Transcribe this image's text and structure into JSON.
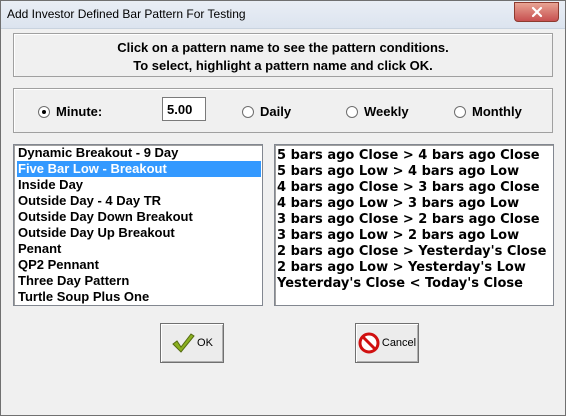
{
  "window": {
    "title": "Add Investor Defined Bar Pattern For Testing"
  },
  "info": {
    "line1": "Click on a pattern name to see the pattern conditions.",
    "line2": "To select, highlight a pattern name and click OK."
  },
  "frequency": {
    "minute_label": "Minute:",
    "minute_value": "5.00",
    "daily_label": "Daily",
    "weekly_label": "Weekly",
    "monthly_label": "Monthly",
    "selected": "Minute"
  },
  "patterns": {
    "items": [
      "Dynamic Breakout - 9 Day",
      "Five Bar Low - Breakout",
      "Inside Day",
      "Outside Day - 4 Day TR",
      "Outside Day Down Breakout",
      "Outside Day Up Breakout",
      "Penant",
      "QP2 Pennant",
      "Three Day Pattern",
      "Turtle Soup Plus One"
    ],
    "selected_index": 1
  },
  "conditions": {
    "items": [
      "5 bars ago Close > 4 bars ago Close",
      "5 bars ago Low > 4 bars ago Low",
      "4 bars ago Close > 3 bars ago Close",
      "4 bars ago Low > 3 bars ago Low",
      "3 bars ago Close > 2 bars ago Close",
      "3 bars ago Low > 2 bars ago Low",
      "2 bars ago Close > Yesterday's Close",
      "2 bars ago Low > Yesterday's Low",
      "Yesterday's Close < Today's Close"
    ]
  },
  "buttons": {
    "ok_label": "OK",
    "cancel_label": "Cancel"
  },
  "icons": {
    "close": "close-icon",
    "ok": "checkmark-icon",
    "cancel": "prohibited-icon"
  },
  "colors": {
    "selection": "#3399ff",
    "checkmark": "#8ab020",
    "cancel_red": "#d01010"
  }
}
